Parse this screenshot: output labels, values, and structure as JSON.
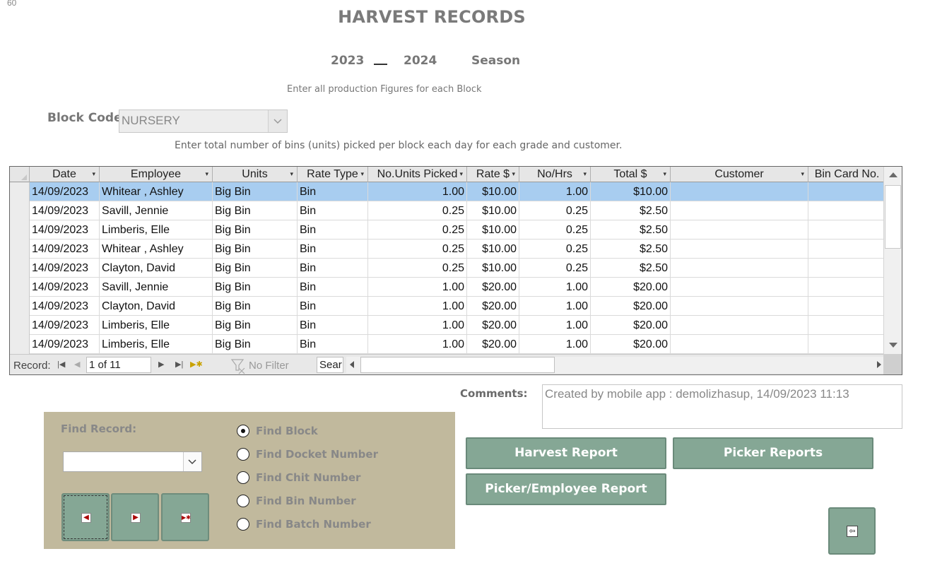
{
  "corner_number": "60",
  "title": "HARVEST RECORDS",
  "season": {
    "start_year": "2023",
    "end_year": "2024",
    "label": "Season"
  },
  "instructions": {
    "top": "Enter all production Figures for each Block",
    "grid": "Enter total number of bins (units) picked per block each day for each grade and customer."
  },
  "block_code": {
    "label": "Block Code:",
    "value": "NURSERY"
  },
  "grid": {
    "columns": [
      "Date",
      "Employee",
      "Units",
      "Rate Type",
      "No.Units Picked",
      "Rate $",
      "No/Hrs",
      "Total $",
      "Customer",
      "Bin Card No."
    ],
    "rows": [
      [
        "14/09/2023",
        "Whitear , Ashley",
        "Big Bin",
        "Bin",
        "1.00",
        "$10.00",
        "1.00",
        "$10.00",
        "",
        ""
      ],
      [
        "14/09/2023",
        "Savill, Jennie",
        "Big Bin",
        "Bin",
        "0.25",
        "$10.00",
        "0.25",
        "$2.50",
        "",
        ""
      ],
      [
        "14/09/2023",
        "Limberis, Elle",
        "Big Bin",
        "Bin",
        "0.25",
        "$10.00",
        "0.25",
        "$2.50",
        "",
        ""
      ],
      [
        "14/09/2023",
        "Whitear , Ashley",
        "Big Bin",
        "Bin",
        "0.25",
        "$10.00",
        "0.25",
        "$2.50",
        "",
        ""
      ],
      [
        "14/09/2023",
        "Clayton, David",
        "Big Bin",
        "Bin",
        "0.25",
        "$10.00",
        "0.25",
        "$2.50",
        "",
        ""
      ],
      [
        "14/09/2023",
        "Savill, Jennie",
        "Big Bin",
        "Bin",
        "1.00",
        "$20.00",
        "1.00",
        "$20.00",
        "",
        ""
      ],
      [
        "14/09/2023",
        "Clayton, David",
        "Big Bin",
        "Bin",
        "1.00",
        "$20.00",
        "1.00",
        "$20.00",
        "",
        ""
      ],
      [
        "14/09/2023",
        "Limberis, Elle",
        "Big Bin",
        "Bin",
        "1.00",
        "$20.00",
        "1.00",
        "$20.00",
        "",
        ""
      ],
      [
        "14/09/2023",
        "Limberis, Elle",
        "Big Bin",
        "Bin",
        "1.00",
        "$20.00",
        "1.00",
        "$20.00",
        "",
        ""
      ]
    ],
    "selected_row": 0
  },
  "record_nav": {
    "label": "Record:",
    "position": "1 of 11",
    "filter": "No Filter",
    "search": "Sear"
  },
  "comments": {
    "label": "Comments:",
    "text": "Created by mobile app : demolizhasup, 14/09/2023 11:13"
  },
  "find": {
    "label": "Find Record:",
    "value": "",
    "options": [
      "Find Block",
      "Find Docket Number",
      "Find Chit Number",
      "Find Bin Number",
      "Find Batch Number"
    ],
    "selected": "Find Block"
  },
  "buttons": {
    "harvest_report": "Harvest Report",
    "picker_reports": "Picker Reports",
    "picker_employee_report": "Picker/Employee Report"
  },
  "colors": {
    "panel": "#c1b99d",
    "button": "#85a795",
    "selected_row": "#a8cdf0"
  }
}
